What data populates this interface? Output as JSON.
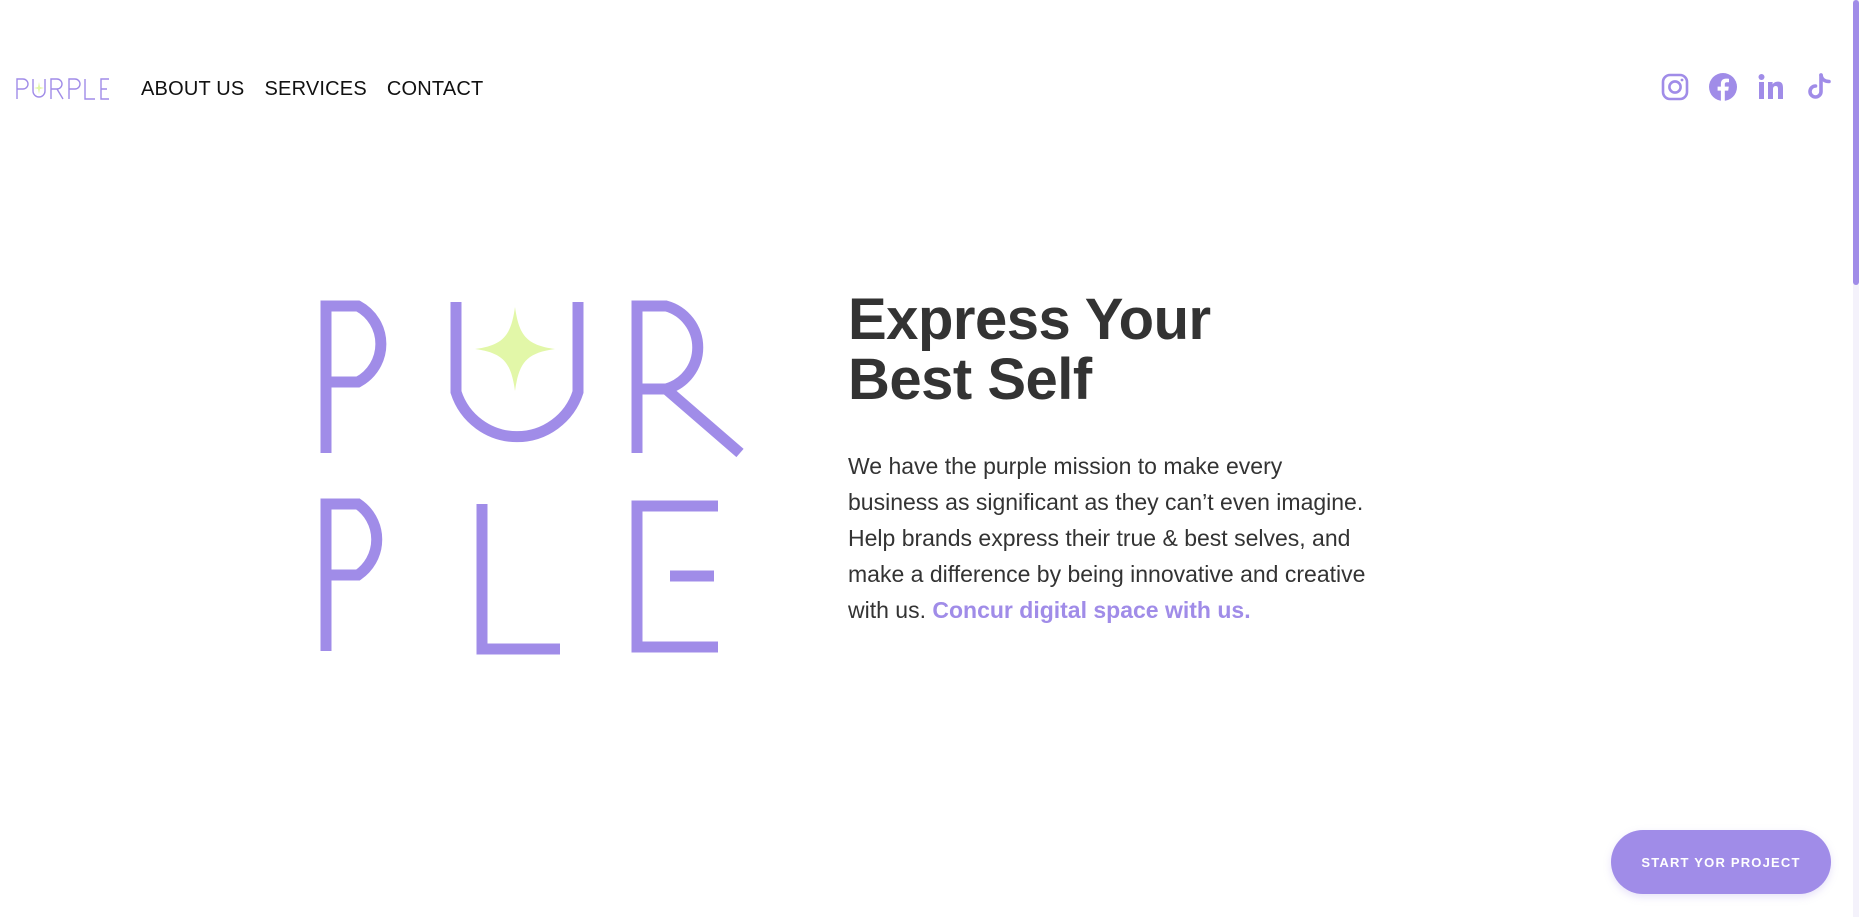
{
  "brand": {
    "name": "PURPLE",
    "color": "#a08ce8",
    "accent": "#e2f7a8"
  },
  "nav": {
    "items": [
      {
        "label": "ABOUT US"
      },
      {
        "label": "SERVICES"
      },
      {
        "label": "CONTACT"
      }
    ]
  },
  "socials": {
    "items": [
      {
        "icon": "instagram-icon"
      },
      {
        "icon": "facebook-icon"
      },
      {
        "icon": "linkedin-icon"
      },
      {
        "icon": "tiktok-icon"
      }
    ]
  },
  "hero": {
    "logo_letters": [
      "P",
      "U",
      "R",
      "P",
      "L",
      "E"
    ],
    "title_line1": "Express Your",
    "title_line2": "Best Self",
    "body": "We have the purple mission to make every business as significant as they can’t even imagine. Help brands express their true & best selves, and make a difference by being innovative and creative with us. ",
    "link": "Concur digital space with us."
  },
  "cta": {
    "label": "START YOR PROJECT"
  },
  "colors": {
    "accent": "#a08ce8",
    "text": "#333333",
    "star": "#e2f7a8"
  }
}
